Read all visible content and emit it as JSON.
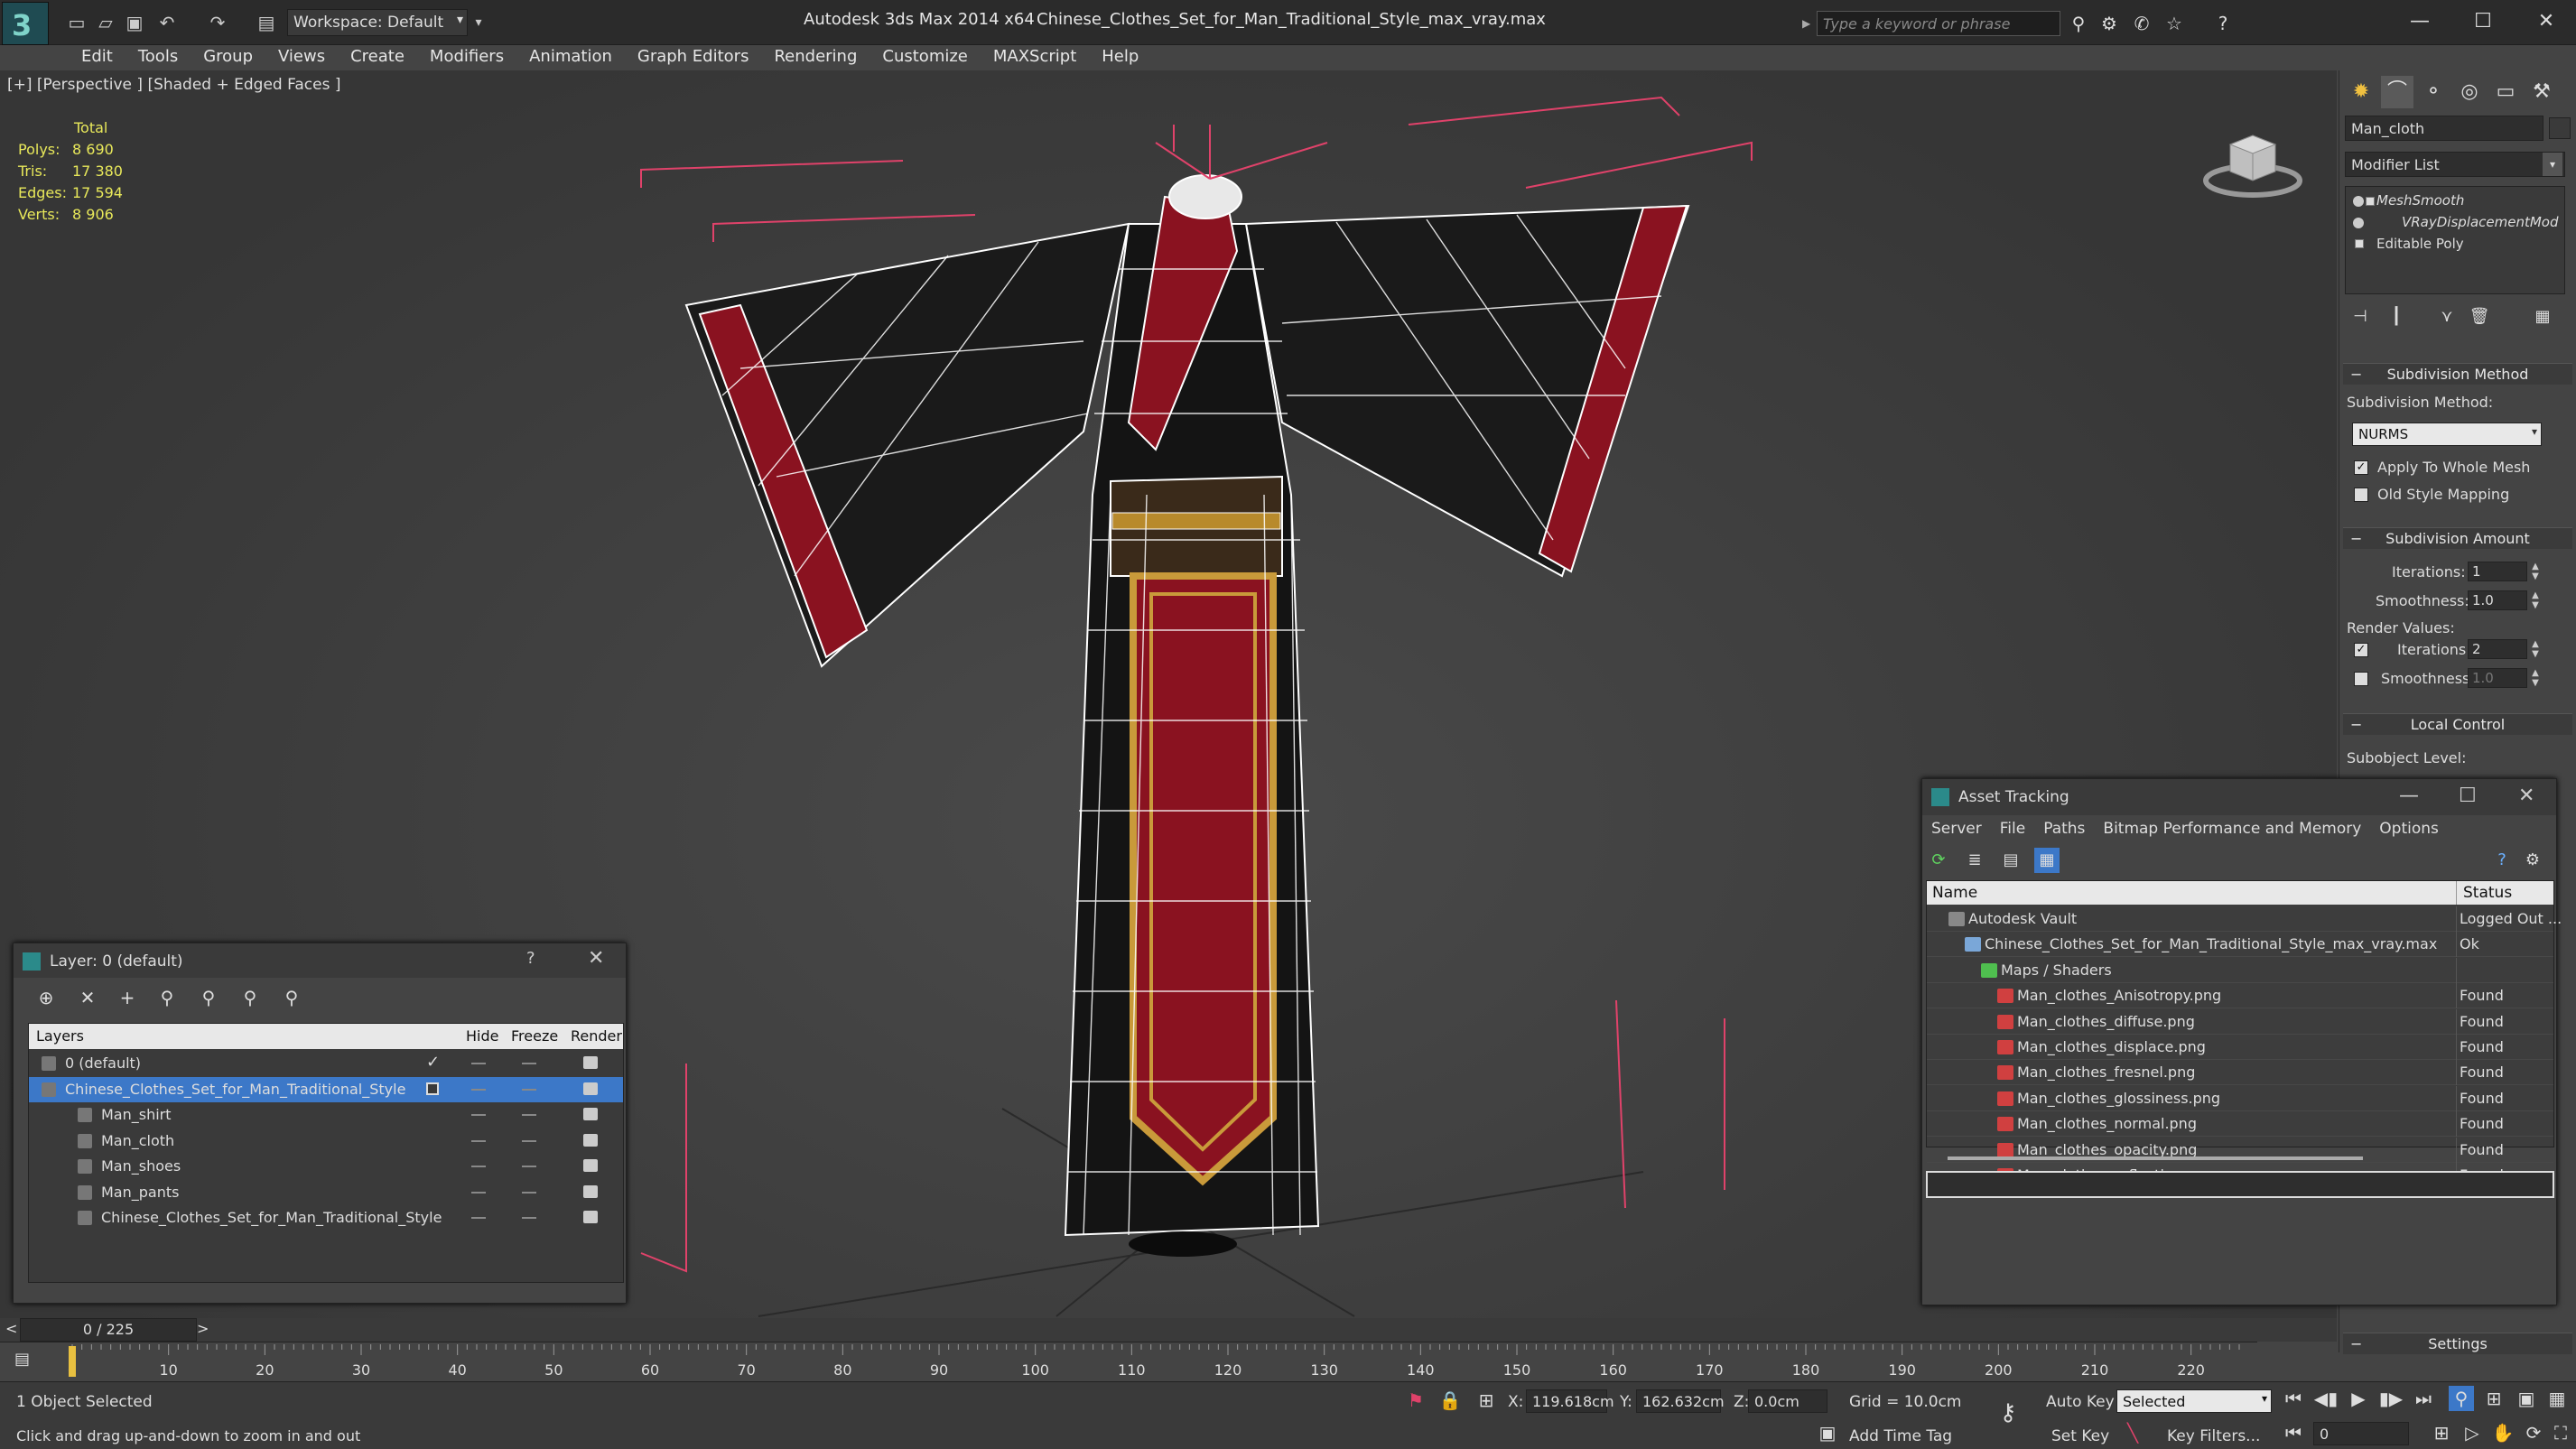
{
  "app": {
    "app_title": "Autodesk 3ds Max  2014 x64",
    "file_title": "Chinese_Clothes_Set_for_Man_Traditional_Style_max_vray.max",
    "workspace_label": "Workspace: Default",
    "search_placeholder": "Type a keyword or phrase"
  },
  "menu": [
    "Edit",
    "Tools",
    "Group",
    "Views",
    "Create",
    "Modifiers",
    "Animation",
    "Graph Editors",
    "Rendering",
    "Customize",
    "MAXScript",
    "Help"
  ],
  "viewport": {
    "label": "[+] [Perspective ] [Shaded + Edged Faces ]",
    "stats": {
      "header": "Total",
      "rows": [
        {
          "label": "Polys:",
          "value": "8 690"
        },
        {
          "label": "Tris:",
          "value": "17 380"
        },
        {
          "label": "Edges:",
          "value": "17 594"
        },
        {
          "label": "Verts:",
          "value": "8 906"
        }
      ]
    },
    "wire_color": "#ffffff",
    "box_color": "#e0426a",
    "trim_color": "#8a1220"
  },
  "command_panel": {
    "object_name": "Man_cloth",
    "modifier_list": "Modifier List",
    "stack": [
      "MeshSmooth",
      "VRayDisplacementMod",
      "Editable Poly"
    ],
    "subdivision_method": {
      "title": "Subdivision Method",
      "label": "Subdivision Method:",
      "value": "NURMS",
      "apply_whole_mesh": "Apply To Whole Mesh",
      "old_style_mapping": "Old Style Mapping"
    },
    "subdivision_amount": {
      "title": "Subdivision Amount",
      "iterations_label": "Iterations:",
      "iterations_value": "1",
      "smoothness_label": "Smoothness:",
      "smoothness_value": "1.0",
      "render_values_label": "Render Values:",
      "render_iterations_label": "Iterations:",
      "render_iterations_value": "2",
      "render_smoothness_label": "Smoothness:",
      "render_smoothness_value": "1.0"
    },
    "local_control": {
      "title": "Local Control",
      "subobject_label": "Subobject Level:"
    },
    "settings_title": "Settings"
  },
  "layer_dialog": {
    "title": "Layer: 0 (default)",
    "help": "?",
    "columns": {
      "layers": "Layers",
      "hide": "Hide",
      "freeze": "Freeze",
      "render": "Render"
    },
    "rows": [
      {
        "name": "0 (default)",
        "indent": 0,
        "selected": false
      },
      {
        "name": "Chinese_Clothes_Set_for_Man_Traditional_Style",
        "indent": 0,
        "selected": true
      },
      {
        "name": "Man_shirt",
        "indent": 1,
        "selected": false
      },
      {
        "name": "Man_cloth",
        "indent": 1,
        "selected": false
      },
      {
        "name": "Man_shoes",
        "indent": 1,
        "selected": false
      },
      {
        "name": "Man_pants",
        "indent": 1,
        "selected": false
      },
      {
        "name": "Chinese_Clothes_Set_for_Man_Traditional_Style",
        "indent": 1,
        "selected": false
      }
    ]
  },
  "asset_dialog": {
    "title": "Asset Tracking",
    "menu": [
      "Server",
      "File",
      "Paths",
      "Bitmap Performance and Memory",
      "Options"
    ],
    "columns": {
      "name": "Name",
      "status": "Status"
    },
    "rows": [
      {
        "name": "Autodesk Vault",
        "status": "Logged Out ...",
        "indent": 1,
        "kind": "vault"
      },
      {
        "name": "Chinese_Clothes_Set_for_Man_Traditional_Style_max_vray.max",
        "status": "Ok",
        "indent": 2,
        "kind": "max"
      },
      {
        "name": "Maps / Shaders",
        "status": "",
        "indent": 3,
        "kind": "folder"
      },
      {
        "name": "Man_clothes_Anisotropy.png",
        "status": "Found",
        "indent": 4,
        "kind": "png"
      },
      {
        "name": "Man_clothes_diffuse.png",
        "status": "Found",
        "indent": 4,
        "kind": "png"
      },
      {
        "name": "Man_clothes_displace.png",
        "status": "Found",
        "indent": 4,
        "kind": "png"
      },
      {
        "name": "Man_clothes_fresnel.png",
        "status": "Found",
        "indent": 4,
        "kind": "png"
      },
      {
        "name": "Man_clothes_glossiness.png",
        "status": "Found",
        "indent": 4,
        "kind": "png"
      },
      {
        "name": "Man_clothes_normal.png",
        "status": "Found",
        "indent": 4,
        "kind": "png"
      },
      {
        "name": "Man_clothes_opacity.png",
        "status": "Found",
        "indent": 4,
        "kind": "png"
      },
      {
        "name": "Man_clothes_reflection.png",
        "status": "Found",
        "indent": 4,
        "kind": "png"
      }
    ]
  },
  "timeline": {
    "frame_label": "0 / 225",
    "ticks": [
      0,
      10,
      20,
      30,
      40,
      50,
      60,
      70,
      80,
      90,
      100,
      110,
      120,
      130,
      140,
      150,
      160,
      170,
      180,
      190,
      200,
      210,
      220
    ],
    "total": 225
  },
  "status": {
    "selection": "1 Object Selected",
    "prompt": "Click and drag up-and-down to zoom in and out",
    "x_label": "X:",
    "x_value": "119.618cm",
    "y_label": "Y:",
    "y_value": "162.632cm",
    "z_label": "Z:",
    "z_value": "0.0cm",
    "grid": "Grid = 10.0cm",
    "add_time_tag": "Add Time Tag",
    "auto_key": "Auto Key",
    "set_key": "Set Key",
    "selected_dropdown": "Selected",
    "key_filters": "Key Filters...",
    "frame_value": "0"
  }
}
